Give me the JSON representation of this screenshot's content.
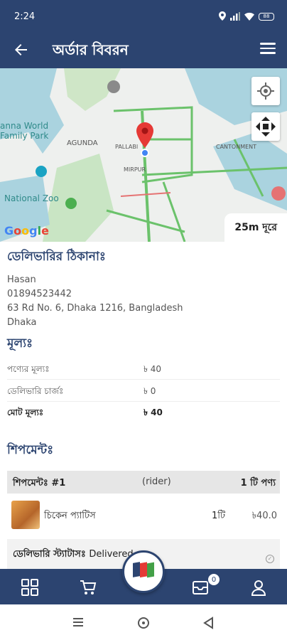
{
  "status_bar": {
    "time": "2:24",
    "battery": "88"
  },
  "app_bar": {
    "title": "অর্ডার বিবরন"
  },
  "map": {
    "distance": "25m দূরে",
    "attribution": "Google",
    "labels": [
      "anna World",
      "Family Park",
      "AGUNDA",
      "PALLABI",
      "CANTONMENT",
      "MIRPUR",
      "National Zoo"
    ]
  },
  "delivery": {
    "title": "ডেলিভারির ঠিকানাঃ",
    "name": "Hasan",
    "phone": "01894523442",
    "address": "63 Rd No. 6, Dhaka 1216, Bangladesh",
    "city": "Dhaka"
  },
  "price": {
    "title": "মূল্যঃ",
    "rows": [
      {
        "label": "পণ্যের মূল্যঃ",
        "value": "৳ 40"
      },
      {
        "label": "ডেলিভারি চার্জঃ",
        "value": "৳ 0"
      },
      {
        "label": "মোট মূল্যঃ",
        "value": "৳ 40"
      }
    ]
  },
  "shipment": {
    "section_title": "শিপমেন্টঃ",
    "header": {
      "label": "শিপমেন্টঃ #1",
      "rider": "(rider)",
      "count": "1 টি পণ্য"
    },
    "item": {
      "name": "চিকেন প্যাটিস",
      "qty": "1টি",
      "price": "৳40.0"
    },
    "status_label": "ডেলিভারি স্ট্যাটাসঃ",
    "status_value": "Delivered"
  },
  "bottom_nav": {
    "cart_badge": "0"
  },
  "colors": {
    "primary": "#2c4470",
    "accent": "#e53935"
  }
}
